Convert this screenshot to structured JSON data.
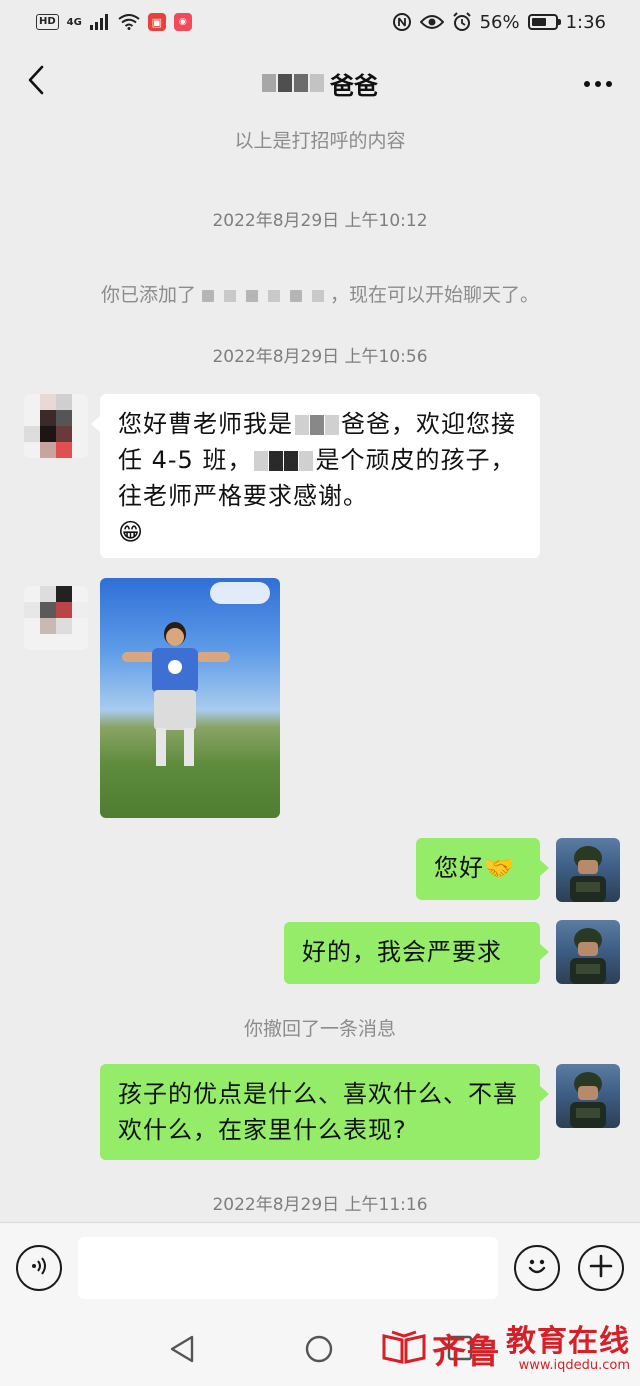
{
  "status_bar": {
    "hd": "HD",
    "network": "4G",
    "battery_percent": "56%",
    "battery_level": 0.56,
    "time": "1:36",
    "icons": [
      "hd-icon",
      "signal-icon",
      "wifi-icon",
      "notification-app-icon",
      "video-app-icon",
      "nfc-icon",
      "eye-icon",
      "alarm-icon",
      "battery-icon"
    ]
  },
  "nav": {
    "title": "爸爸",
    "back_icon": "chevron-left-icon",
    "more_icon": "more-icon"
  },
  "messages": {
    "greeting_note": "以上是打招呼的内容",
    "time_1": "2022年8月29日 上午10:12",
    "added_prefix": "你已添加了",
    "added_suffix": "，现在可以开始聊天了。",
    "time_2": "2022年8月29日 上午10:56",
    "msg_in_1_part1": "您好曹老师我是",
    "msg_in_1_part2": "爸爸，欢迎您接任 4-5 班，",
    "msg_in_1_part3": "是个顽皮的孩子，往老师严格要求感谢。",
    "msg_in_1_emoji": "😁",
    "msg_out_1": "您好",
    "msg_out_1_emoji": "🤝",
    "msg_out_2": "好的，我会严要求",
    "recall_note": "你撤回了一条消息",
    "msg_out_3": "孩子的优点是什么、喜欢什么、不喜欢什么，在家里什么表现?",
    "time_3": "2022年8月29日 上午11:16"
  },
  "input_bar": {
    "voice_icon": "voice-icon",
    "emoji_icon": "emoji-icon",
    "plus_icon": "plus-icon",
    "input_value": ""
  },
  "watermark": {
    "logo": "齐鲁",
    "name": "教育在线",
    "url": "www.iqdedu.com"
  }
}
